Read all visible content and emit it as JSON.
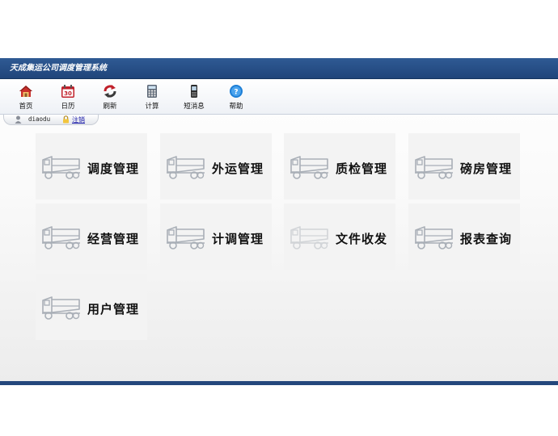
{
  "app": {
    "title": "天成集运公司调度管理系统"
  },
  "toolbar": {
    "items": [
      {
        "label": "首页",
        "icon": "home-icon"
      },
      {
        "label": "日历",
        "icon": "calendar-icon",
        "calendar_day": "30"
      },
      {
        "label": "刷新",
        "icon": "refresh-icon"
      },
      {
        "label": "计算",
        "icon": "calculator-icon"
      },
      {
        "label": "短消息",
        "icon": "phone-icon"
      },
      {
        "label": "帮助",
        "icon": "help-icon"
      }
    ]
  },
  "user": {
    "name": "diaodu",
    "logout_label": "注销"
  },
  "modules": [
    {
      "label": "调度管理",
      "icon": "truck-icon"
    },
    {
      "label": "外运管理",
      "icon": "truck-icon"
    },
    {
      "label": "质检管理",
      "icon": "truck-icon"
    },
    {
      "label": "磅房管理",
      "icon": "truck-icon"
    },
    {
      "label": "经营管理",
      "icon": "truck-icon"
    },
    {
      "label": "计调管理",
      "icon": "truck-icon"
    },
    {
      "label": "文件收发",
      "icon": "truck-icon",
      "faded": true
    },
    {
      "label": "报表查询",
      "icon": "truck-icon"
    },
    {
      "label": "用户管理",
      "icon": "truck-icon"
    }
  ],
  "colors": {
    "header": "#24477c",
    "tile": "#f3f3f3",
    "icon_red": "#c0202a",
    "icon_blue": "#1e7fd6"
  }
}
